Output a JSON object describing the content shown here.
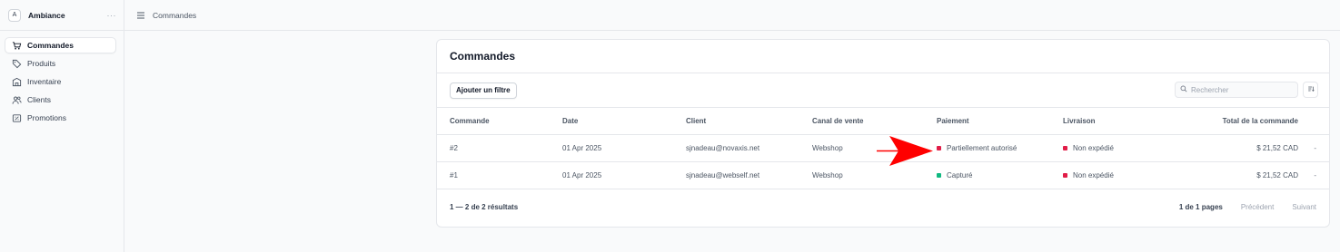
{
  "store": {
    "avatar_letter": "A",
    "name": "Ambiance",
    "menu": "···"
  },
  "sidebar": {
    "items": [
      {
        "label": "Commandes",
        "icon": "cart-icon",
        "active": true
      },
      {
        "label": "Produits",
        "icon": "tag-icon",
        "active": false
      },
      {
        "label": "Inventaire",
        "icon": "building-icon",
        "active": false
      },
      {
        "label": "Clients",
        "icon": "users-icon",
        "active": false
      },
      {
        "label": "Promotions",
        "icon": "receipt-percent-icon",
        "active": false
      }
    ]
  },
  "topbar": {
    "breadcrumb": "Commandes",
    "icon": "menu-icon"
  },
  "orders": {
    "title": "Commandes",
    "filter_button": "Ajouter un filtre",
    "search_placeholder": "Rechercher",
    "columns": [
      "Commande",
      "Date",
      "Client",
      "Canal de vente",
      "Paiement",
      "Livraison",
      "Total de la commande"
    ],
    "rows": [
      {
        "order": "#2",
        "date": "01 Apr 2025",
        "client": "sjnadeau@novaxis.net",
        "channel": "Webshop",
        "payment": "Partiellement autorisé",
        "payment_color": "#e11d48",
        "shipping": "Non expédié",
        "shipping_color": "#e11d48",
        "total": "$ 21,52 CAD",
        "more": "-"
      },
      {
        "order": "#1",
        "date": "01 Apr 2025",
        "client": "sjnadeau@webself.net",
        "channel": "Webshop",
        "payment": "Capturé",
        "payment_color": "#10b981",
        "shipping": "Non expédié",
        "shipping_color": "#e11d48",
        "total": "$ 21,52 CAD",
        "more": "-"
      }
    ],
    "result_count": "1 — 2 de 2 résultats",
    "pagination": {
      "pages": "1 de 1 pages",
      "prev": "Précédent",
      "next": "Suivant"
    }
  },
  "annotation": {
    "arrow_color": "#ff0000"
  }
}
